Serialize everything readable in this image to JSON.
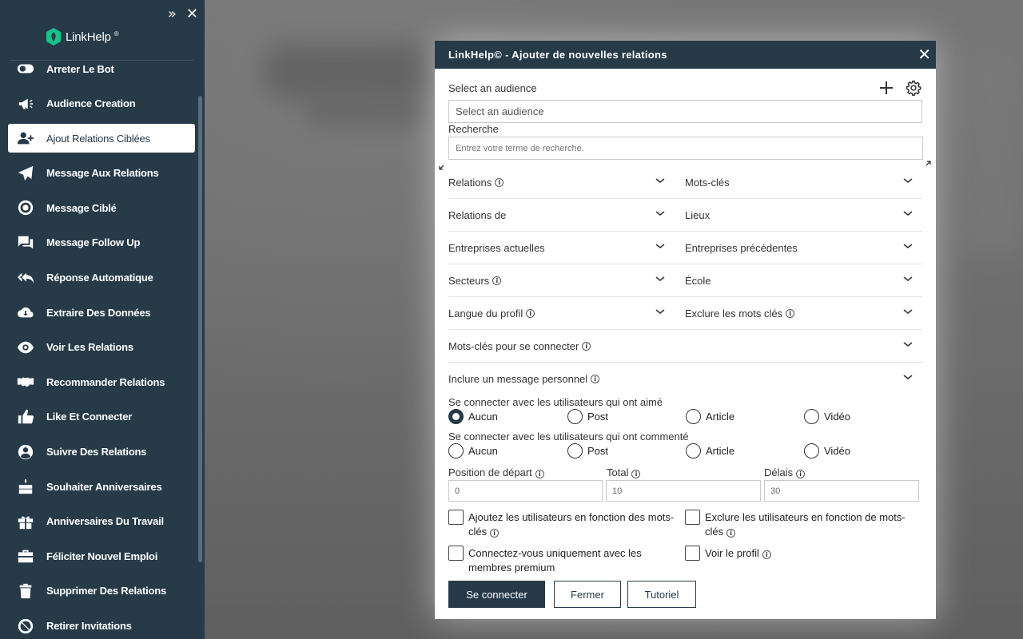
{
  "sidebar": {
    "brand": "LinkHelp",
    "brand_mark": "®",
    "controls": {
      "collapse": "»",
      "close": "✕"
    },
    "items": [
      {
        "label": "Arreter Le Bot",
        "icon": "toggle-icon"
      },
      {
        "label": "Audience Creation",
        "icon": "megaphone-icon"
      },
      {
        "label": "Ajout Relations Ciblées",
        "icon": "add-user-icon",
        "active": true
      },
      {
        "label": "Message Aux Relations",
        "icon": "send-icon"
      },
      {
        "label": "Message Ciblé",
        "icon": "target-icon"
      },
      {
        "label": "Message Follow Up",
        "icon": "chat-icon"
      },
      {
        "label": "Réponse Automatique",
        "icon": "reply-all-icon"
      },
      {
        "label": "Extraire Des Données",
        "icon": "cloud-download-icon"
      },
      {
        "label": "Voir Les Relations",
        "icon": "eye-icon"
      },
      {
        "label": "Recommander Relations",
        "icon": "handshake-icon"
      },
      {
        "label": "Like Et Connecter",
        "icon": "thumbs-up-icon"
      },
      {
        "label": "Suivre Des Relations",
        "icon": "user-circle-icon"
      },
      {
        "label": "Souhaiter Anniversaires",
        "icon": "cake-icon"
      },
      {
        "label": "Anniversaires Du Travail",
        "icon": "gift-icon"
      },
      {
        "label": "Féliciter Nouvel Emploi",
        "icon": "briefcase-icon"
      },
      {
        "label": "Supprimer Des Relations",
        "icon": "trash-icon"
      },
      {
        "label": "Retirer Invitations",
        "icon": "block-icon"
      }
    ]
  },
  "modal": {
    "title": "LinkHelp© - Ajouter de nouvelles relations",
    "close": "✕",
    "audience": {
      "label": "Select an audience",
      "placeholder": "Select an audience"
    },
    "search": {
      "label": "Recherche",
      "placeholder": "Entrez votre terme de recherche."
    },
    "filters": [
      {
        "left": "Relations",
        "left_info": true,
        "right": "Mots-clés",
        "right_info": false
      },
      {
        "left": "Relations de",
        "left_info": false,
        "right": "Lieux",
        "right_info": false
      },
      {
        "left": "Entreprises actuelles",
        "left_info": false,
        "right": "Entreprises précédentes",
        "right_info": false
      },
      {
        "left": "Secteurs",
        "left_info": true,
        "right": "École",
        "right_info": false
      },
      {
        "left": "Langue du profil",
        "left_info": true,
        "right": "Exclure les mots clés",
        "right_info": true
      }
    ],
    "full_filters": [
      {
        "label": "Mots-clés pour se connecter"
      },
      {
        "label": "Inclure un message personnel"
      }
    ],
    "liked": {
      "title": "Se connecter avec les utilisateurs qui ont aimé",
      "options": [
        "Aucun",
        "Post",
        "Article",
        "Vidéo"
      ],
      "selected": "Aucun"
    },
    "commented": {
      "title": "Se connecter avec les utilisateurs qui ont commenté",
      "options": [
        "Aucun",
        "Post",
        "Article",
        "Vidéo"
      ],
      "selected": ""
    },
    "numbers": {
      "start_label": "Position de départ",
      "start_value": "0",
      "total_label": "Total",
      "total_value": "10",
      "delay_label": "Délais",
      "delay_value": "30"
    },
    "checks": {
      "add_by_keywords_1": "Ajoutez les utilisateurs en fonction des mots-",
      "add_by_keywords_2": "clés",
      "exclude_by_keywords_1": "Exclure les utilisateurs en fonction de mots-",
      "exclude_by_keywords_2": "clés",
      "premium_1": "Connectez-vous uniquement avec les",
      "premium_2": "membres premium",
      "view_profile": "Voir le profil"
    },
    "buttons": {
      "connect": "Se connecter",
      "close": "Fermer",
      "tutorial": "Tutoriel"
    }
  }
}
